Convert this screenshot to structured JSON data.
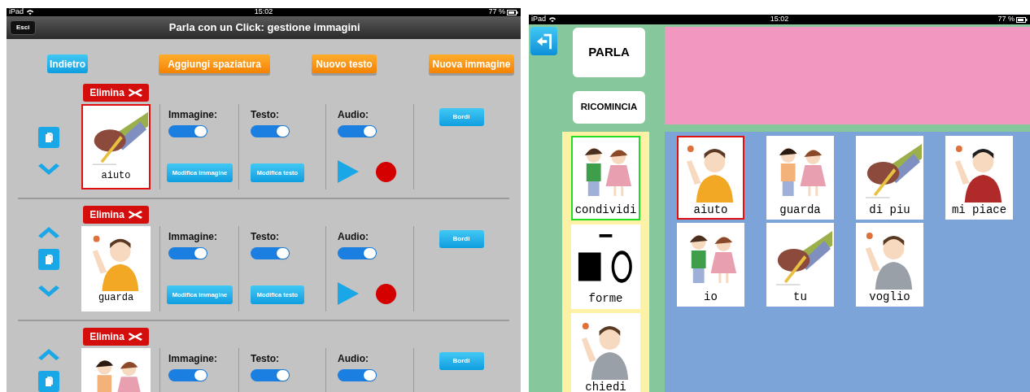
{
  "left_screen": {
    "status_bar": {
      "device": "iPad",
      "time": "15:02",
      "battery": "77 %"
    },
    "nav_bar": {
      "back_button": "Esci",
      "title": "Parla con un Click: gestione immagini"
    },
    "toolbar": [
      {
        "label": "Indietro",
        "kind": "blue"
      },
      {
        "label": "Aggiungi spaziatura",
        "kind": "orange"
      },
      {
        "label": "Nuovo testo",
        "kind": "orange"
      },
      {
        "label": "Nuova immagine",
        "kind": "orange"
      }
    ],
    "rows": [
      {
        "delete_button": "Elimina",
        "can_move_up": false,
        "can_move_down": true,
        "selected": true,
        "label": "aiuto",
        "image_heading": "Immagine:",
        "image_on": true,
        "text_heading": "Testo:",
        "text_on": true,
        "audio_heading": "Audio:",
        "audio_on": true,
        "edit_image_button": "Modifica immagine",
        "edit_text_button": "Modifica testo",
        "borders_button": "Bordi"
      },
      {
        "delete_button": "Elimina",
        "can_move_up": true,
        "can_move_down": true,
        "selected": false,
        "label": "guarda",
        "image_heading": "Immagine:",
        "image_on": true,
        "text_heading": "Testo:",
        "text_on": true,
        "audio_heading": "Audio:",
        "audio_on": true,
        "edit_image_button": "Modifica immagine",
        "edit_text_button": "Modifica testo",
        "borders_button": "Bordi"
      },
      {
        "delete_button": "Elimina",
        "can_move_up": true,
        "can_move_down": false,
        "selected": false,
        "image_heading": "Immagine:",
        "image_on": true,
        "text_heading": "Testo:",
        "text_on": true,
        "audio_heading": "Audio:",
        "audio_on": true,
        "borders_button": "Bordi"
      }
    ]
  },
  "right_screen": {
    "status_bar": {
      "device": "iPad",
      "time": "15:02",
      "battery": "77 %"
    },
    "actions": [
      "PARLA",
      "RICOMINCIA"
    ],
    "categories": [
      {
        "label": "condividi",
        "selected": true,
        "kind": "picture"
      },
      {
        "label": "forme",
        "selected": false,
        "kind": "shapes"
      },
      {
        "label": "chiedi",
        "selected": false,
        "kind": "picture"
      }
    ],
    "symbols": [
      {
        "label": "aiuto",
        "selected": true
      },
      {
        "label": "guarda",
        "selected": false
      },
      {
        "label": "di piu",
        "selected": false
      },
      {
        "label": "mi piace",
        "selected": false
      },
      {
        "label": "io",
        "selected": false
      },
      {
        "label": "tu",
        "selected": false
      },
      {
        "label": "voglio",
        "selected": false
      }
    ]
  }
}
